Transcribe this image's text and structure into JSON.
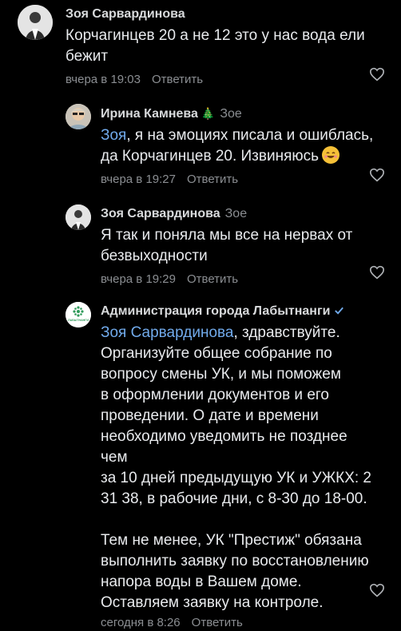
{
  "comments": [
    {
      "author": "Зоя Сарвардинова",
      "text": "Корчагинцев 20 а не 12 это у нас вода ели бежит",
      "time": "вчера в 19:03",
      "reply_label": "Ответить",
      "avatar_icon": "user-photo-icon"
    },
    {
      "author": "Ирина Камнева",
      "badge": "🎄",
      "reply_to": "Зое",
      "mention": "Зоя",
      "text": ", я на эмоциях писала и ошиблась, да Корчагинцев 20. Извиняюсь",
      "time": "вчера в 19:27",
      "reply_label": "Ответить",
      "avatar_icon": "user-photo-icon"
    },
    {
      "author": "Зоя Сарвардинова",
      "reply_to": "Зое",
      "text": "Я так и поняла мы все на нервах от безвыходности",
      "time": "вчера в 19:29",
      "reply_label": "Ответить",
      "avatar_icon": "user-photo-icon"
    },
    {
      "author": "Администрация города Лабытнанги",
      "mention": "Зоя Сарвардинова",
      "text_lines": [
        ", здравствуйте.",
        "Организуйте общее собрание по",
        "вопросу смены УК, и мы поможем",
        "в оформлении документов и его",
        "проведении. О дате и времени",
        "необходимо уведомить не позднее чем",
        "за 10 дней предыдущую УК и УЖКХ: 2",
        "31 38, в рабочие дни, с 8-30 до 18-00.",
        "",
        "Тем не менее, УК \"Престиж\" обязана",
        "выполнить заявку по восстановлению",
        "напора воды в Вашем доме.",
        "Оставляем заявку на контроле."
      ],
      "time": "сегодня в 8:26",
      "reply_label": "Ответить",
      "avatar_icon": "city-logo-icon",
      "avatar_text": "ЛАБЫТНАНГИ"
    }
  ],
  "colors": {
    "background": "#000000",
    "link": "#71aaeb",
    "meta": "#8b8e92"
  }
}
